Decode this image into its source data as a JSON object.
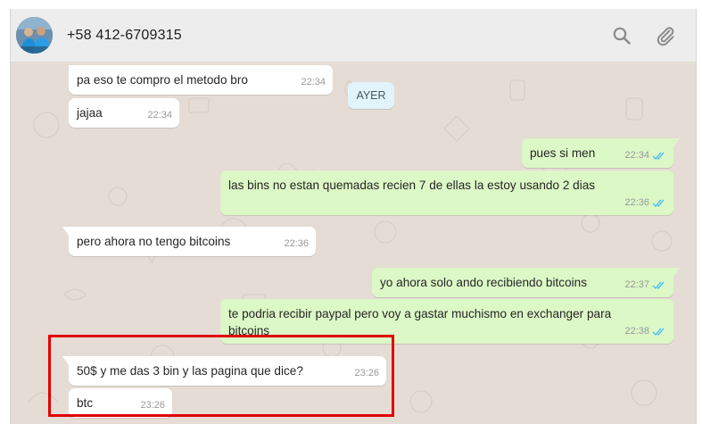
{
  "header": {
    "contact_name": "+58 412-6709315",
    "avatar_icon": "user-avatar",
    "search_icon": "search-icon",
    "attach_icon": "paperclip-icon"
  },
  "date_separator": "AYER",
  "messages": [
    {
      "direction": "in",
      "text": "pa eso te compro el metodo bro",
      "time": "22:34"
    },
    {
      "direction": "in",
      "text": "jajaa",
      "time": "22:34"
    },
    {
      "direction": "out",
      "text": "pues si men",
      "time": "22:34",
      "status": "read"
    },
    {
      "direction": "out",
      "text": "las bins no estan quemadas recien 7 de ellas la estoy usando 2 dias",
      "time": "22:36",
      "status": "read"
    },
    {
      "direction": "in",
      "text": "pero ahora no tengo bitcoins",
      "time": "22:36"
    },
    {
      "direction": "out",
      "text": "yo ahora solo ando recibiendo bitcoins",
      "time": "22:37",
      "status": "read"
    },
    {
      "direction": "out",
      "text": "te podria recibir paypal pero voy a gastar muchismo en exchanger para bitcoins",
      "time": "22:38",
      "status": "read"
    },
    {
      "direction": "in",
      "text": "50$ y me das 3 bin y las pagina que dice?",
      "time": "23:26"
    },
    {
      "direction": "in",
      "text": "btc",
      "time": "23:26"
    }
  ],
  "colors": {
    "incoming_bubble": "#ffffff",
    "outgoing_bubble": "#dcf8c6",
    "chat_background": "#e5ddd5",
    "read_ticks": "#4fc3f7",
    "highlight_border": "#e00000"
  }
}
